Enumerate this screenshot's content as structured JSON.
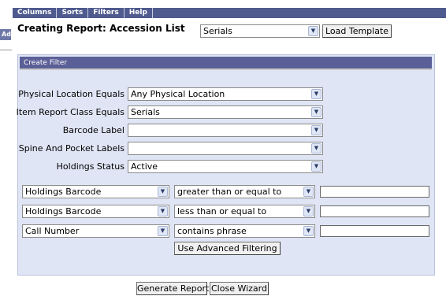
{
  "menu": [
    "Columns",
    "Sorts",
    "Filters",
    "Help"
  ],
  "left_stub_text": "Ad",
  "title": "Creating Report: Accession List",
  "template_select": {
    "value": "Serials"
  },
  "load_template_label": "Load Template",
  "panel_title": "Create Filter",
  "filters": [
    {
      "label": "Physical Location Equals",
      "value": "Any Physical Location"
    },
    {
      "label": "Item Report Class Equals",
      "value": "Serials"
    },
    {
      "label": "Barcode Label",
      "value": ""
    },
    {
      "label": "Spine And Pocket Labels",
      "value": ""
    },
    {
      "label": "Holdings Status",
      "value": "Active"
    }
  ],
  "conditions": [
    {
      "field": "Holdings Barcode",
      "operator": "greater than or equal to",
      "value": ""
    },
    {
      "field": "Holdings Barcode",
      "operator": "less than or equal to",
      "value": ""
    },
    {
      "field": "Call Number",
      "operator": "contains phrase",
      "value": ""
    }
  ],
  "advanced_filter_label": "Use Advanced Filtering",
  "generate_label": "Generate Report",
  "close_label": "Close Wizard",
  "colors": {
    "menu_bg": "#4f5b8e",
    "panel_bg": "#dfe5f4",
    "panel_header": "#5b5f97"
  },
  "icons": {
    "dropdown": "chevron-down-icon"
  }
}
